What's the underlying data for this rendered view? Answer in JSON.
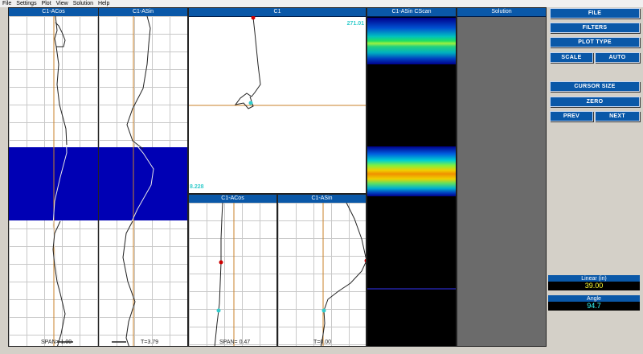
{
  "menu": [
    "File",
    "Settings",
    "Plot",
    "View",
    "Solution",
    "Help"
  ],
  "panels": {
    "acos_left": {
      "title": "C1-ACos",
      "footer": "SPAN= 1.00"
    },
    "asin_left": {
      "title": "C1-ASin",
      "footer": "T=3.79"
    },
    "c1": {
      "title": "C1",
      "value_top": "271.01",
      "value_bottom": "8.228"
    },
    "cscan": {
      "title": "C1-ASin CScan"
    },
    "solution": {
      "title": "Solution"
    },
    "acos_small": {
      "title": "C1-ACos",
      "footer": "SPAN= 0.47"
    },
    "asin_small": {
      "title": "C1-ASin",
      "footer": "T=0.00"
    }
  },
  "buttons": {
    "file": "FILE",
    "filters": "FILTERS",
    "plot_type": "PLOT TYPE",
    "scale": "SCALE",
    "auto": "AUTO",
    "cursor_size": "CURSOR SIZE",
    "zero": "ZERO",
    "prev": "PREV",
    "next": "NEXT"
  },
  "readouts": {
    "linear": {
      "label": "Linear (in)",
      "value": "39.00",
      "color": "#ffff33"
    },
    "angle": {
      "label": "Angle",
      "value": "94.7",
      "color": "#33ffff"
    }
  },
  "colors": {
    "panel_title_bg": "#0a58a8",
    "selection_band": "#0000b4",
    "cursor_line": "#c8822a",
    "marker_red": "#cc0000",
    "marker_cyan": "#33cccc",
    "solution_bg": "#6b6b6b"
  }
}
